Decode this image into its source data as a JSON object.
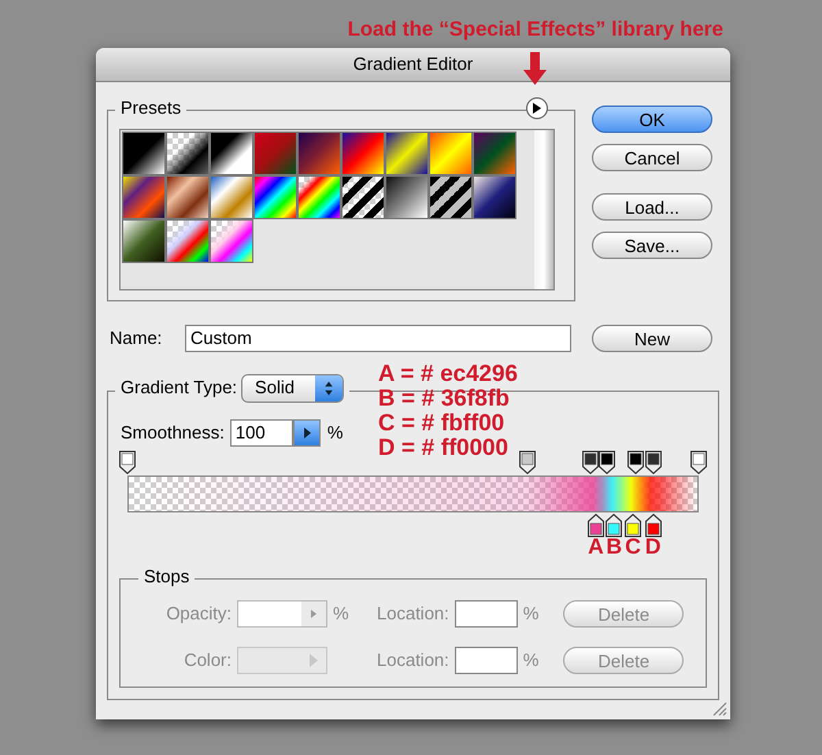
{
  "annotation": {
    "title": "Load the “Special Effects” library here"
  },
  "window": {
    "title": "Gradient Editor"
  },
  "presets": {
    "label": "Presets"
  },
  "buttons": [
    {
      "label": "OK",
      "default": true
    },
    {
      "label": "Cancel",
      "default": false
    },
    {
      "label": "Load...",
      "default": false
    },
    {
      "label": "Save...",
      "default": false
    }
  ],
  "name": {
    "label": "Name:",
    "value": "Custom",
    "button": "New"
  },
  "gradient": {
    "type_label": "Gradient Type:",
    "type_value": "Solid",
    "smoothness_label": "Smoothness:",
    "smoothness_value": "100",
    "smoothness_unit": "%",
    "opacity_stops": [
      {
        "color": "#ffffff",
        "level": 0
      },
      {
        "color": "#c8c8c8",
        "level": 0.7
      },
      {
        "color": "#303030",
        "level": 0.81
      },
      {
        "color": "#000000",
        "level": 0.84
      },
      {
        "color": "#000000",
        "level": 0.89
      },
      {
        "color": "#303030",
        "level": 0.92
      },
      {
        "color": "#ffffff",
        "level": 1
      }
    ],
    "color_stops": [
      {
        "letter": "A",
        "color": "#ec4296",
        "level": 0.82
      },
      {
        "letter": "B",
        "color": "#36f8fb",
        "level": 0.852
      },
      {
        "letter": "C",
        "color": "#fbff00",
        "level": 0.885
      },
      {
        "letter": "D",
        "color": "#ff0000",
        "level": 0.92
      }
    ]
  },
  "color_notes": [
    "A = # ec4296",
    "B = # 36f8fb",
    "C = # fbff00",
    "D = # ff0000"
  ],
  "stops": {
    "label": "Stops",
    "disabled": true,
    "rows": [
      {
        "kind": "opacity",
        "label": "Opacity:",
        "unit": "%",
        "location_label": "Location:",
        "location_unit": "%",
        "button": "Delete"
      },
      {
        "kind": "color",
        "label": "Color:",
        "location_label": "Location:",
        "location_unit": "%",
        "button": "Delete"
      }
    ]
  }
}
